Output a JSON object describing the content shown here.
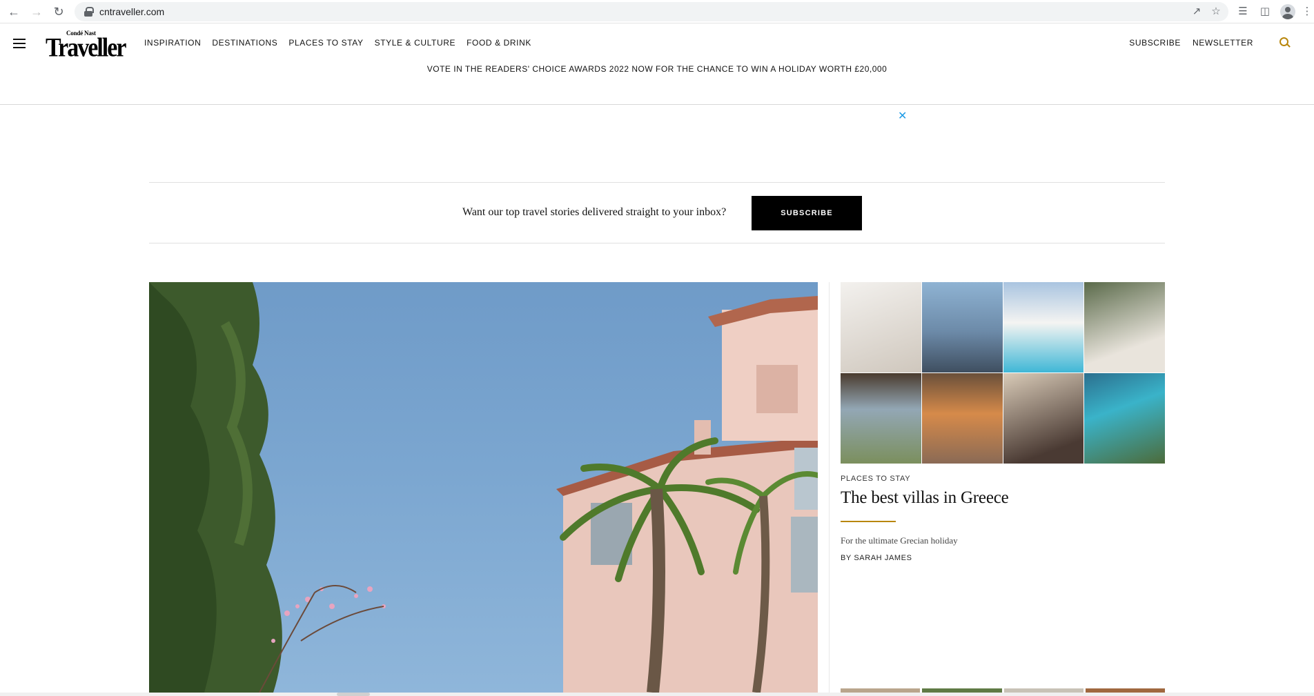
{
  "browser": {
    "url": "cntraveller.com",
    "icons": [
      "back-arrow-icon",
      "forward-arrow-icon",
      "reload-icon",
      "lock-icon",
      "share-icon",
      "star-icon",
      "reading-list-icon",
      "side-panel-icon",
      "profile-icon",
      "kebab-menu-icon"
    ]
  },
  "header": {
    "logo_small": "Condé Nast",
    "logo_main": "Traveller",
    "nav": [
      {
        "label": "INSPIRATION"
      },
      {
        "label": "DESTINATIONS"
      },
      {
        "label": "PLACES TO STAY"
      },
      {
        "label": "STYLE & CULTURE"
      },
      {
        "label": "FOOD & DRINK"
      }
    ],
    "right_links": [
      {
        "label": "SUBSCRIBE"
      },
      {
        "label": "NEWSLETTER"
      }
    ],
    "promo": "VOTE IN THE READERS' CHOICE AWARDS 2022 NOW FOR THE CHANCE TO WIN A HOLIDAY WORTH £20,000"
  },
  "ad": {
    "close_label": "✕"
  },
  "newsletter": {
    "text": "Want our top travel stories delivered straight to your inbox?",
    "button": "SUBSCRIBE"
  },
  "story": {
    "kicker": "PLACES TO STAY",
    "title": "The best villas in Greece",
    "dek": "For the ultimate Grecian holiday",
    "byline": "BY SARAH JAMES"
  },
  "colors": {
    "accent_gold": "#b8860b",
    "ad_close_blue": "#1e9be6",
    "button_black": "#000000"
  }
}
